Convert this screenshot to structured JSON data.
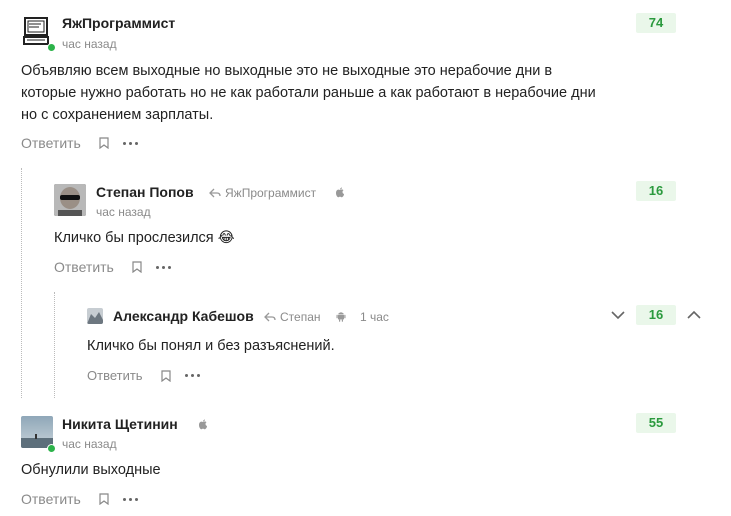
{
  "comments": [
    {
      "author": "ЯжПрограммист",
      "time": "час назад",
      "text": "Объявляю всем выходные но выходные это не выходные это нерабочие дни в которые нужно работать но не как работали раньше а как работают в нерабочие дни но с сохранением зарплаты.",
      "rating": "74",
      "reply_label": "Ответить"
    },
    {
      "author": "Степан Попов",
      "reply_to": "ЯжПрограммист",
      "platform": "apple-icon",
      "time": "час назад",
      "text": "Кличко бы прослезился",
      "emoji": "😂",
      "rating": "16",
      "reply_label": "Ответить"
    },
    {
      "author": "Александр Кабешов",
      "reply_to": "Степан",
      "platform": "android-icon",
      "time": "1 час",
      "text": "Кличко бы понял и без разъяснений.",
      "rating": "16",
      "reply_label": "Ответить"
    },
    {
      "author": "Никита Щетинин",
      "platform": "apple-icon",
      "time": "час назад",
      "text": "Обнулили выходные",
      "rating": "55",
      "reply_label": "Ответить"
    }
  ],
  "colors": {
    "rating_bg": "#eaf7ea",
    "rating_text": "#2b9a3e",
    "online": "#2cb34a"
  }
}
